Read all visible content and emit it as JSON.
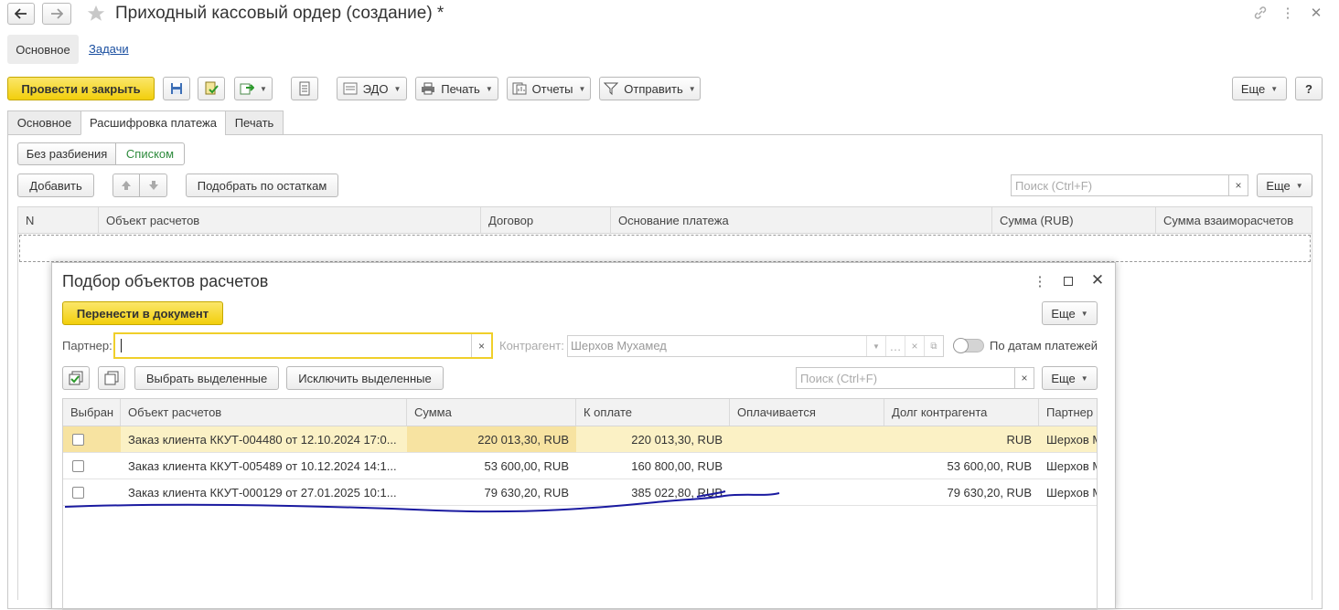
{
  "window": {
    "title": "Приходный кассовый ордер (создание) *",
    "section_tabs": [
      "Основное",
      "Задачи"
    ]
  },
  "toolbar": {
    "post_close": "Провести и закрыть",
    "edo": "ЭДО",
    "print": "Печать",
    "reports": "Отчеты",
    "send": "Отправить",
    "more": "Еще",
    "help": "?"
  },
  "doc_tabs": [
    "Основное",
    "Расшифровка платежа",
    "Печать"
  ],
  "split": {
    "no_split": "Без разбиения",
    "list": "Списком"
  },
  "list_toolbar": {
    "add": "Добавить",
    "pick_by_balance": "Подобрать по остаткам",
    "search_placeholder": "Поиск (Ctrl+F)",
    "more": "Еще"
  },
  "main_grid": {
    "columns": [
      "N",
      "Объект расчетов",
      "Договор",
      "Основание платежа",
      "Сумма (RUB)",
      "Сумма взаиморасчетов"
    ]
  },
  "dialog": {
    "title": "Подбор объектов расчетов",
    "transfer": "Перенести в документ",
    "more": "Еще",
    "partner_label": "Партнер:",
    "partner_value": "",
    "counterparty_label": "Контрагент:",
    "counterparty_value": "Шерхов Мухамед",
    "by_dates_label": "По датам платежей",
    "select_selected": "Выбрать выделенные",
    "exclude_selected": "Исключить выделенные",
    "search_placeholder": "Поиск (Ctrl+F)",
    "more2": "Еще",
    "columns": [
      "Выбран",
      "Объект расчетов",
      "Сумма",
      "К оплате",
      "Оплачивается",
      "Долг контрагента",
      "Партнер"
    ],
    "rows": [
      {
        "checked": false,
        "object": "Заказ клиента ККУТ-004480 от 12.10.2024 17:0...",
        "sum": "220 013,30, RUB",
        "to_pay": "220 013,30, RUB",
        "paying": "",
        "debt": "RUB",
        "partner": "Шерхов М"
      },
      {
        "checked": false,
        "object": "Заказ клиента ККУТ-005489 от 10.12.2024 14:1...",
        "sum": "53 600,00, RUB",
        "to_pay": "160 800,00, RUB",
        "paying": "",
        "debt": "53 600,00, RUB",
        "partner": "Шерхов М"
      },
      {
        "checked": false,
        "object": "Заказ клиента ККУТ-000129 от 27.01.2025 10:1...",
        "sum": "79 630,20, RUB",
        "to_pay": "385 022,80, RUB",
        "paying": "",
        "debt": "79 630,20, RUB",
        "partner": "Шерхов М"
      }
    ]
  },
  "colors": {
    "accent_yellow": "#f2cf0c",
    "active_green": "#2e8b3d",
    "link_blue": "#1a4fa0",
    "annotation_ink": "#1a1aa0"
  }
}
